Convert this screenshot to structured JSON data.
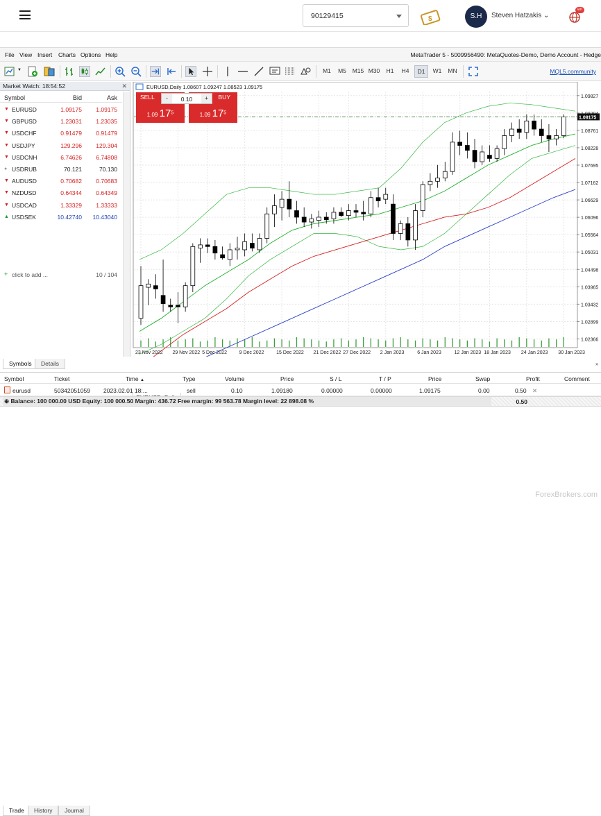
{
  "app_header": {
    "account_number": "90129415",
    "avatar_initials": "S.H",
    "user_name": "Steven Hatzakis",
    "language_badge": "en"
  },
  "menu": [
    "File",
    "View",
    "Insert",
    "Charts",
    "Options",
    "Help"
  ],
  "window_title": "MetaTrader 5 - 5009956490: MetaQuotes-Demo, Demo Account - Hedge",
  "timeframes": [
    "M1",
    "M5",
    "M15",
    "M30",
    "H1",
    "H4",
    "D1",
    "W1",
    "MN"
  ],
  "selected_timeframe": "D1",
  "mql5_link": "MQL5.community",
  "market_watch": {
    "title": "Market Watch: 18:54:52",
    "col_symbol": "Symbol",
    "col_bid": "Bid",
    "col_ask": "Ask",
    "rows": [
      {
        "symbol": "EURUSD",
        "bid": "1.09175",
        "ask": "1.09175",
        "dir": "down"
      },
      {
        "symbol": "GBPUSD",
        "bid": "1.23031",
        "ask": "1.23035",
        "dir": "down"
      },
      {
        "symbol": "USDCHF",
        "bid": "0.91479",
        "ask": "0.91479",
        "dir": "down"
      },
      {
        "symbol": "USDJPY",
        "bid": "129.296",
        "ask": "129.304",
        "dir": "down"
      },
      {
        "symbol": "USDCNH",
        "bid": "6.74626",
        "ask": "6.74808",
        "dir": "down"
      },
      {
        "symbol": "USDRUB",
        "bid": "70.121",
        "ask": "70.130",
        "dir": "flat"
      },
      {
        "symbol": "AUDUSD",
        "bid": "0.70682",
        "ask": "0.70683",
        "dir": "down"
      },
      {
        "symbol": "NZDUSD",
        "bid": "0.64344",
        "ask": "0.64349",
        "dir": "down"
      },
      {
        "symbol": "USDCAD",
        "bid": "1.33329",
        "ask": "1.33333",
        "dir": "down"
      },
      {
        "symbol": "USDSEK",
        "bid": "10.42740",
        "ask": "10.43040",
        "dir": "up"
      }
    ],
    "add_label": "click to add ...",
    "count": "10 / 104",
    "tabs": [
      "Symbols",
      "Details"
    ]
  },
  "chart": {
    "info": "EURUSD,Daily  1.08607 1.09247 1.08523 1.09175",
    "tab_label": "EURUSD, Daily",
    "one_click": {
      "sell_label": "SELL",
      "buy_label": "BUY",
      "lot": "0.10",
      "sell_price_small": "1.09",
      "sell_price_big": "17",
      "sell_price_sup": "5",
      "buy_price_small": "1.09",
      "buy_price_big": "17",
      "buy_price_sup": "5"
    }
  },
  "chart_data": {
    "type": "candlestick",
    "symbol": "EURUSD",
    "timeframe": "Daily",
    "current_price": "1.09175",
    "ylim": [
      1.021,
      1.0995
    ],
    "y_ticks": [
      "1.09827",
      "1.09294",
      "1.08761",
      "1.08228",
      "1.07695",
      "1.07162",
      "1.06629",
      "1.06096",
      "1.05564",
      "1.05031",
      "1.04498",
      "1.03965",
      "1.03432",
      "1.02899",
      "1.02366"
    ],
    "x_ticks": [
      "23 Nov 2022",
      "29 Nov 2022",
      "5 Dec 2022",
      "9 Dec 2022",
      "15 Dec 2022",
      "21 Dec 2022",
      "27 Dec 2022",
      "2 Jan 2023",
      "6 Jan 2023",
      "12 Jan 2023",
      "18 Jan 2023",
      "24 Jan 2023",
      "30 Jan 2023"
    ],
    "candles": [
      {
        "o": 1.03,
        "h": 1.046,
        "l": 1.028,
        "c": 1.04
      },
      {
        "o": 1.0395,
        "h": 1.042,
        "l": 1.034,
        "c": 1.0405
      },
      {
        "o": 1.04,
        "h": 1.0435,
        "l": 1.036,
        "c": 1.039
      },
      {
        "o": 1.037,
        "h": 1.048,
        "l": 1.032,
        "c": 1.0345
      },
      {
        "o": 1.034,
        "h": 1.036,
        "l": 1.032,
        "c": 1.0335
      },
      {
        "o": 1.034,
        "h": 1.038,
        "l": 1.0285,
        "c": 1.0335
      },
      {
        "o": 1.0335,
        "h": 1.041,
        "l": 1.032,
        "c": 1.04
      },
      {
        "o": 1.04,
        "h": 1.053,
        "l": 1.038,
        "c": 1.052
      },
      {
        "o": 1.0515,
        "h": 1.0545,
        "l": 1.047,
        "c": 1.0525
      },
      {
        "o": 1.0525,
        "h": 1.0545,
        "l": 1.05,
        "c": 1.052
      },
      {
        "o": 1.052,
        "h": 1.054,
        "l": 1.048,
        "c": 1.05
      },
      {
        "o": 1.0495,
        "h": 1.052,
        "l": 1.048,
        "c": 1.0485
      },
      {
        "o": 1.048,
        "h": 1.053,
        "l": 1.046,
        "c": 1.051
      },
      {
        "o": 1.051,
        "h": 1.055,
        "l": 1.048,
        "c": 1.0515
      },
      {
        "o": 1.051,
        "h": 1.056,
        "l": 1.049,
        "c": 1.0535
      },
      {
        "o": 1.053,
        "h": 1.056,
        "l": 1.0505,
        "c": 1.0515
      },
      {
        "o": 1.051,
        "h": 1.056,
        "l": 1.05,
        "c": 1.0545
      },
      {
        "o": 1.0545,
        "h": 1.064,
        "l": 1.053,
        "c": 1.062
      },
      {
        "o": 1.062,
        "h": 1.068,
        "l": 1.058,
        "c": 1.0645
      },
      {
        "o": 1.064,
        "h": 1.069,
        "l": 1.06,
        "c": 1.0665
      },
      {
        "o": 1.0665,
        "h": 1.072,
        "l": 1.061,
        "c": 1.0635
      },
      {
        "o": 1.063,
        "h": 1.066,
        "l": 1.059,
        "c": 1.061
      },
      {
        "o": 1.061,
        "h": 1.064,
        "l": 1.058,
        "c": 1.0595
      },
      {
        "o": 1.0595,
        "h": 1.062,
        "l": 1.0575,
        "c": 1.0605
      },
      {
        "o": 1.06,
        "h": 1.063,
        "l": 1.058,
        "c": 1.061
      },
      {
        "o": 1.061,
        "h": 1.0625,
        "l": 1.059,
        "c": 1.0602
      },
      {
        "o": 1.0605,
        "h": 1.064,
        "l": 1.059,
        "c": 1.0625
      },
      {
        "o": 1.0625,
        "h": 1.064,
        "l": 1.061,
        "c": 1.0615
      },
      {
        "o": 1.0615,
        "h": 1.065,
        "l": 1.06,
        "c": 1.063
      },
      {
        "o": 1.063,
        "h": 1.065,
        "l": 1.061,
        "c": 1.0625
      },
      {
        "o": 1.0625,
        "h": 1.066,
        "l": 1.06,
        "c": 1.062
      },
      {
        "o": 1.062,
        "h": 1.069,
        "l": 1.061,
        "c": 1.067
      },
      {
        "o": 1.067,
        "h": 1.07,
        "l": 1.064,
        "c": 1.066
      },
      {
        "o": 1.0665,
        "h": 1.07,
        "l": 1.065,
        "c": 1.068
      },
      {
        "o": 1.065,
        "h": 1.068,
        "l": 1.054,
        "c": 1.056
      },
      {
        "o": 1.056,
        "h": 1.06,
        "l": 1.054,
        "c": 1.059
      },
      {
        "o": 1.059,
        "h": 1.061,
        "l": 1.052,
        "c": 1.054
      },
      {
        "o": 1.054,
        "h": 1.065,
        "l": 1.051,
        "c": 1.063
      },
      {
        "o": 1.063,
        "h": 1.072,
        "l": 1.061,
        "c": 1.071
      },
      {
        "o": 1.071,
        "h": 1.0745,
        "l": 1.069,
        "c": 1.072
      },
      {
        "o": 1.072,
        "h": 1.077,
        "l": 1.07,
        "c": 1.073
      },
      {
        "o": 1.073,
        "h": 1.078,
        "l": 1.072,
        "c": 1.075
      },
      {
        "o": 1.075,
        "h": 1.087,
        "l": 1.074,
        "c": 1.084
      },
      {
        "o": 1.084,
        "h": 1.0875,
        "l": 1.08,
        "c": 1.083
      },
      {
        "o": 1.083,
        "h": 1.087,
        "l": 1.079,
        "c": 1.0815
      },
      {
        "o": 1.0815,
        "h": 1.085,
        "l": 1.076,
        "c": 1.078
      },
      {
        "o": 1.078,
        "h": 1.083,
        "l": 1.077,
        "c": 1.081
      },
      {
        "o": 1.08,
        "h": 1.083,
        "l": 1.078,
        "c": 1.079
      },
      {
        "o": 1.079,
        "h": 1.083,
        "l": 1.078,
        "c": 1.082
      },
      {
        "o": 1.082,
        "h": 1.088,
        "l": 1.08,
        "c": 1.086
      },
      {
        "o": 1.086,
        "h": 1.09,
        "l": 1.084,
        "c": 1.088
      },
      {
        "o": 1.088,
        "h": 1.091,
        "l": 1.085,
        "c": 1.087
      },
      {
        "o": 1.087,
        "h": 1.0925,
        "l": 1.085,
        "c": 1.0905
      },
      {
        "o": 1.0905,
        "h": 1.0925,
        "l": 1.086,
        "c": 1.088
      },
      {
        "o": 1.088,
        "h": 1.091,
        "l": 1.084,
        "c": 1.086
      },
      {
        "o": 1.086,
        "h": 1.0895,
        "l": 1.081,
        "c": 1.085
      },
      {
        "o": 1.085,
        "h": 1.088,
        "l": 1.083,
        "c": 1.086
      },
      {
        "o": 1.086,
        "h": 1.0925,
        "l": 1.0852,
        "c": 1.09175
      }
    ],
    "ma_blue": [
      1.009,
      1.012,
      1.015,
      1.018,
      1.021,
      1.024,
      1.027,
      1.03,
      1.033,
      1.036,
      1.039,
      1.042,
      1.045,
      1.048,
      1.052,
      1.055,
      1.058,
      1.061,
      1.064,
      1.067,
      1.0695
    ],
    "ma_red": [
      1.015,
      1.02,
      1.025,
      1.029,
      1.033,
      1.038,
      1.042,
      1.046,
      1.049,
      1.051,
      1.053,
      1.055,
      1.057,
      1.059,
      1.061,
      1.062,
      1.064,
      1.067,
      1.071,
      1.075,
      1.079
    ],
    "ma_green": [
      1.026,
      1.03,
      1.035,
      1.04,
      1.044,
      1.048,
      1.053,
      1.057,
      1.059,
      1.06,
      1.061,
      1.062,
      1.064,
      1.066,
      1.069,
      1.073,
      1.077,
      1.08,
      1.083,
      1.085,
      1.0865
    ],
    "bb_upper": [
      1.048,
      1.051,
      1.056,
      1.062,
      1.068,
      1.07,
      1.07,
      1.069,
      1.068,
      1.068,
      1.069,
      1.07,
      1.076,
      1.084,
      1.09,
      1.093,
      1.095,
      1.096,
      1.0955,
      1.0945,
      1.0935
    ],
    "bb_lower": [
      1.019,
      1.022,
      1.026,
      1.03,
      1.036,
      1.043,
      1.048,
      1.052,
      1.056,
      1.056,
      1.055,
      1.052,
      1.051,
      1.052,
      1.056,
      1.062,
      1.068,
      1.074,
      1.079,
      1.081,
      1.083
    ],
    "volumes": [
      6,
      8,
      5,
      7,
      9,
      6,
      7,
      8,
      5,
      6,
      9,
      7,
      6,
      8,
      7,
      9,
      5,
      6,
      8,
      7,
      6,
      9,
      8,
      7,
      6,
      5,
      7,
      8,
      6,
      7,
      9,
      8,
      7,
      6,
      8,
      9,
      7,
      6,
      8,
      7,
      6,
      9,
      8,
      7,
      6,
      8,
      7,
      5,
      8,
      7,
      6,
      9,
      8,
      7,
      6,
      8,
      7,
      9
    ],
    "colors": {
      "up": "#ffffff",
      "down": "#000000",
      "ma_blue": "#2b3fc8",
      "ma_red": "#d62020",
      "ma_green": "#1fb02c",
      "bb": "#36b840",
      "volume": "#3aa03a",
      "price_line": "#3a7a3a"
    }
  },
  "toolbox": {
    "headers": [
      "Symbol",
      "Ticket",
      "Time",
      "Type",
      "Volume",
      "Price",
      "S / L",
      "T / P",
      "Price",
      "Swap",
      "Profit",
      "Comment"
    ],
    "trade": {
      "symbol": "eurusd",
      "ticket": "50342051059",
      "time": "2023.02.01 18:...",
      "type": "sell",
      "volume": "0.10",
      "price": "1.09180",
      "sl": "0.00000",
      "tp": "0.00000",
      "cur_price": "1.09175",
      "swap": "0.00",
      "profit": "0.50"
    },
    "balance_line": "Balance: 100 000.00 USD  Equity: 100 000.50  Margin: 436.72  Free margin: 99 563.78  Margin level: 22 898.08 %",
    "balance_profit": "0.50",
    "tabs": [
      "Trade",
      "History",
      "Journal"
    ]
  },
  "watermark": "ForexBrokers.com"
}
